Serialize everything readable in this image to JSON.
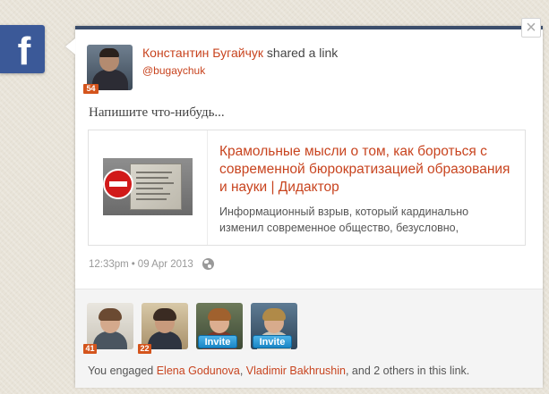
{
  "facebook_tab": {
    "glyph": "f"
  },
  "close_button": {
    "glyph": "×"
  },
  "post": {
    "author_name": "Константин Бугайчук",
    "action": "shared a link",
    "handle": "@bugaychuk",
    "klout_score": "54",
    "message": "Напишите что-нибудь..."
  },
  "link": {
    "title": "Крамольные мысли о том, как бороться с современной бюрократизацией образования и науки | Дидактор",
    "description": "Информационный взрыв, который кардинально изменил современное общество, безусловно,"
  },
  "meta": {
    "time": "12:33pm",
    "separator": "•",
    "date": "09 Apr 2013"
  },
  "engaged": {
    "people": [
      {
        "klout": "41",
        "invite": ""
      },
      {
        "klout": "22",
        "invite": ""
      },
      {
        "klout": "",
        "invite": "Invite"
      },
      {
        "klout": "",
        "invite": "Invite"
      }
    ],
    "prefix": "You engaged ",
    "name1": "Elena Godunova",
    "comma": ", ",
    "name2": "Vladimir Bakhrushin",
    "suffix": ", and 2 others in this link."
  },
  "colors": {
    "brand_facebook": "#3b5998",
    "link_orange": "#c8441f",
    "klout_badge": "#d4541c",
    "invite_blue": "#1a86c6",
    "card_top_border": "#3b4d6b"
  }
}
